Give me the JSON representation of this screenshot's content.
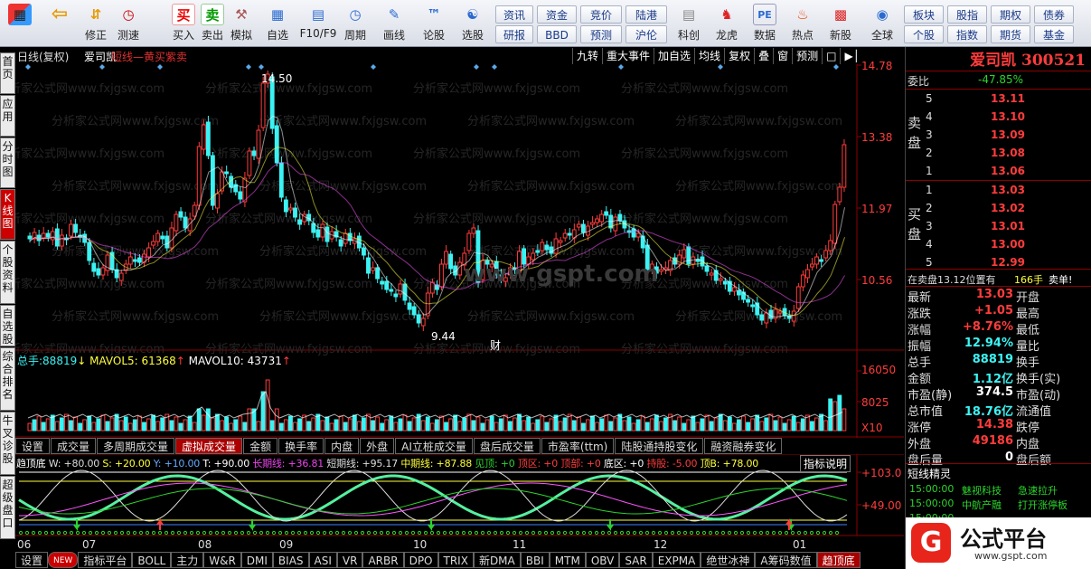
{
  "toolbar": {
    "items": [
      {
        "label": "",
        "icon": "grid-icon"
      },
      {
        "label": "",
        "icon": "back-arrow-icon"
      },
      {
        "label": "修正",
        "icon": "up-down-arrow-icon"
      },
      {
        "label": "测速",
        "icon": "clock-icon"
      },
      {
        "label": "买入",
        "icon": "buy-icon",
        "glyph": "买"
      },
      {
        "label": "卖出",
        "icon": "sell-icon",
        "glyph": "卖"
      },
      {
        "label": "模拟",
        "icon": "gavel-icon"
      },
      {
        "label": "自选",
        "icon": "portfolio-icon"
      },
      {
        "label": "F10/F9",
        "icon": "f10-icon"
      },
      {
        "label": "周期",
        "icon": "cycle-icon"
      },
      {
        "label": "画线",
        "icon": "pencil-icon"
      },
      {
        "label": "论股",
        "icon": "discuss-icon"
      },
      {
        "label": "选股",
        "icon": "pick-stock-icon"
      }
    ],
    "small_buttons": [
      "资讯",
      "资金",
      "竞价",
      "陆港",
      "研报",
      "BBD",
      "预测",
      "沪伦"
    ],
    "items2": [
      {
        "label": "科创",
        "icon": "kechuang-icon"
      },
      {
        "label": "龙虎",
        "icon": "dragon-tiger-icon"
      },
      {
        "label": "数据",
        "icon": "pe-icon"
      },
      {
        "label": "热点",
        "icon": "hot-icon"
      },
      {
        "label": "新股",
        "icon": "ipo-icon"
      },
      {
        "label": "全球",
        "icon": "globe-icon"
      }
    ],
    "small_buttons2": [
      "板块",
      "股指",
      "期权",
      "债券",
      "个股",
      "指数",
      "期货",
      "基金"
    ]
  },
  "side_tabs": [
    "首页",
    "应用",
    "分时图",
    "K线图",
    "个股资料",
    "自选股",
    "综合排名",
    "牛叉诊股",
    "超级盘口"
  ],
  "chart": {
    "period_label": "日线(复权)",
    "stock_name": "爱司凯",
    "strategy": "短线—黄买紫卖",
    "buttons": [
      "九转",
      "重大事件",
      "加自选",
      "均线",
      "复权",
      "叠",
      "窗",
      "预测"
    ],
    "price_labels": [
      "14.78",
      "13.38",
      "11.97",
      "10.56"
    ],
    "high_label": "14.50",
    "low_label": "9.44",
    "cai_marker": "财",
    "watermark": "www.gspt.com",
    "watermark_tile": "分析家公式网www.fxjgsw.com",
    "volume_header": {
      "label": "总手:",
      "total": "88819",
      "arrow": "↓",
      "mavol5": "MAVOL5: 61368",
      "mavol5_arrow": "↑",
      "mavol10": "MAVOL10: 43731",
      "mavol10_arrow": "↑"
    },
    "volume_labels": [
      "16050",
      "8025",
      "X10"
    ],
    "tabs1": [
      "设置",
      "成交量",
      "多周期成交量",
      "虚拟成交量",
      "金额",
      "换手率",
      "内盘",
      "外盘",
      "AI立桩成交量",
      "盘后成交量",
      "市盈率(ttm)",
      "陆股通持股变化",
      "融资融券变化"
    ],
    "tabs1_active": "虚拟成交量",
    "indicator": {
      "name": "趋顶底",
      "items": [
        "W: +80.00",
        "S: +20.00",
        "Y: +10.00",
        "T: +90.00",
        "长期线: +36.81",
        "短期线: +95.17",
        "中期线: +87.88",
        "见顶: +0",
        "顶区: +0",
        "顶部: +0",
        "底区: +0",
        "持股: -5.00",
        "顶B: +78.00"
      ],
      "help": "指标说明",
      "labels": [
        "+103.0",
        "+49.00"
      ]
    },
    "months": [
      "06",
      "07",
      "08",
      "09",
      "10",
      "11",
      "12",
      "01"
    ],
    "tabs2": [
      "设置",
      "NEW",
      "指标平台",
      "BOLL",
      "主力",
      "W&R",
      "DMI",
      "BIAS",
      "ASI",
      "VR",
      "ARBR",
      "DPO",
      "TRIX",
      "新DMA",
      "BBI",
      "MTM",
      "OBV",
      "SAR",
      "EXPMA",
      "绝世冰神",
      "A筹码数值",
      "趋顶底"
    ],
    "tabs2_active": "趋顶底"
  },
  "colors": {
    "up": "#ff3c3c",
    "down": "#3cf2f2",
    "bg": "#000000",
    "panel_line": "#8b0000"
  },
  "quote": {
    "name": "爱司凯",
    "code": "300521",
    "weibi_label": "委比",
    "weibi": "-47.85%",
    "sell_label": "卖盘",
    "buy_label": "买盘",
    "sell": [
      {
        "n": "5",
        "p": "13.11"
      },
      {
        "n": "4",
        "p": "13.10"
      },
      {
        "n": "3",
        "p": "13.09"
      },
      {
        "n": "2",
        "p": "13.08"
      },
      {
        "n": "1",
        "p": "13.06"
      }
    ],
    "buy": [
      {
        "n": "1",
        "p": "13.03"
      },
      {
        "n": "2",
        "p": "13.02"
      },
      {
        "n": "3",
        "p": "13.01"
      },
      {
        "n": "4",
        "p": "13.00"
      },
      {
        "n": "5",
        "p": "12.99"
      }
    ],
    "notice": "在卖盘13.12位置有",
    "notice_qty": "166手",
    "notice_tag": "卖单!",
    "stats": [
      {
        "l": "最新",
        "v": "13.03",
        "vc": "red",
        "l2": "开盘",
        "v2": ""
      },
      {
        "l": "涨跌",
        "v": "+1.05",
        "vc": "red",
        "l2": "最高",
        "v2": ""
      },
      {
        "l": "涨幅",
        "v": "+8.76%",
        "vc": "red",
        "l2": "最低",
        "v2": ""
      },
      {
        "l": "振幅",
        "v": "12.94%",
        "vc": "cyan",
        "l2": "量比",
        "v2": ""
      },
      {
        "l": "总手",
        "v": "88819",
        "vc": "cyan",
        "l2": "换手",
        "v2": ""
      },
      {
        "l": "金额",
        "v": "1.12亿",
        "vc": "cyan",
        "l2": "换手(实)",
        "v2": ""
      },
      {
        "l": "市盈(静)",
        "v": "374.5",
        "vc": "white",
        "l2": "市盈(动)",
        "v2": ""
      },
      {
        "l": "总市值",
        "v": "18.76亿",
        "vc": "cyan",
        "l2": "流通值",
        "v2": ""
      },
      {
        "l": "涨停",
        "v": "14.38",
        "vc": "red",
        "l2": "跌停",
        "v2": ""
      },
      {
        "l": "外盘",
        "v": "49186",
        "vc": "red",
        "l2": "内盘",
        "v2": ""
      },
      {
        "l": "盘后量",
        "v": "0",
        "vc": "white",
        "l2": "盘后额",
        "v2": ""
      }
    ],
    "elves_title": "短线精灵",
    "elves": [
      {
        "t": "15:00:00",
        "n": "魅视科技",
        "e": "急速拉升"
      },
      {
        "t": "15:00:00",
        "n": "中航产融",
        "e": "打开涨停板"
      },
      {
        "t": "15:00:00",
        "n": "",
        "e": ""
      }
    ],
    "brand": "公式平台",
    "brand_url": "www.gspt.com",
    "brand_mark": "G"
  }
}
